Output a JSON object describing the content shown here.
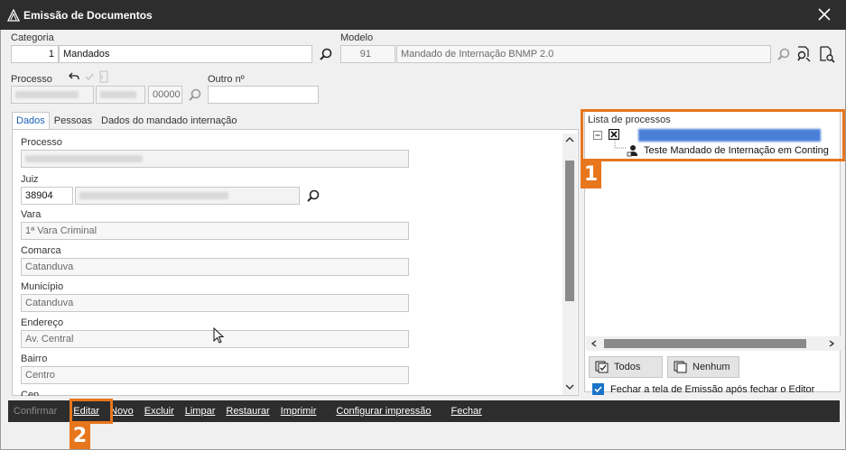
{
  "window": {
    "title": "Emissão de Documentos"
  },
  "header": {
    "categoria_label": "Categoria",
    "categoria_code": "1",
    "categoria_value": "Mandados",
    "modelo_label": "Modelo",
    "modelo_code": "91",
    "modelo_value": "Mandado de Internação BNMP 2.0",
    "processo_label": "Processo",
    "processo_suffix": "00000",
    "outro_label": "Outro nº"
  },
  "tabs": [
    {
      "label": "Dados"
    },
    {
      "label": "Pessoas"
    },
    {
      "label": "Dados do mandado internação"
    }
  ],
  "form": {
    "processo_label": "Processo",
    "juiz_label": "Juiz",
    "juiz_code": "38904",
    "vara_label": "Vara",
    "vara_value": "1ª Vara Criminal",
    "comarca_label": "Comarca",
    "comarca_value": "Catanduva",
    "municipio_label": "Município",
    "municipio_value": "Catanduva",
    "endereco_label": "Endereço",
    "endereco_value": "Av. Central",
    "bairro_label": "Bairro",
    "bairro_value": "Centro",
    "cep_label": "Cep"
  },
  "process_list": {
    "title": "Lista de processos",
    "child_item": "Teste Mandado de Internação em Conting",
    "todos_label": "Todos",
    "nenhum_label": "Nenhum",
    "close_option_label": "Fechar a tela de Emissão após fechar o Editor"
  },
  "callouts": {
    "one": "1",
    "two": "2"
  },
  "bottombar": [
    {
      "label": "Confirmar",
      "disabled": true
    },
    {
      "label": "Editar"
    },
    {
      "label": "Novo"
    },
    {
      "label": "Excluir"
    },
    {
      "label": "Limpar"
    },
    {
      "label": "Restaurar"
    },
    {
      "label": "Imprimir"
    },
    {
      "label": "Configurar impressão"
    },
    {
      "label": "Fechar"
    }
  ],
  "colors": {
    "accent": "#e8761c",
    "titlebar": "#2d2d2d",
    "selection": "#1a73c8"
  }
}
